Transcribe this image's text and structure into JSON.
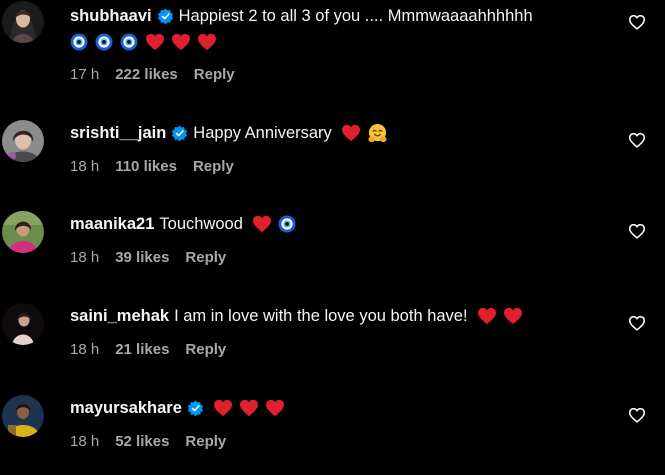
{
  "comments": [
    {
      "username": "shubhaavi",
      "verified": true,
      "text": "Happiest 2 to all 3 of you .... Mmmwaaaahhhhhh",
      "emojis_line2": [
        "nazar-amulet",
        "nazar-amulet",
        "nazar-amulet",
        "red-heart",
        "red-heart",
        "red-heart"
      ],
      "time": "17 h",
      "likes": "222 likes",
      "reply": "Reply"
    },
    {
      "username": "srishti__jain",
      "verified": true,
      "text": "Happy Anniversary",
      "emojis": [
        "red-heart",
        "hugging-face"
      ],
      "time": "18 h",
      "likes": "110 likes",
      "reply": "Reply"
    },
    {
      "username": "maanika21",
      "verified": false,
      "text": "Touchwood",
      "emojis": [
        "red-heart",
        "nazar-amulet"
      ],
      "time": "18 h",
      "likes": "39 likes",
      "reply": "Reply"
    },
    {
      "username": "saini_mehak",
      "verified": false,
      "text": "I am in love with the love you both have!",
      "emojis": [
        "red-heart",
        "red-heart"
      ],
      "time": "18 h",
      "likes": "21 likes",
      "reply": "Reply"
    },
    {
      "username": "mayursakhare",
      "verified": true,
      "text": "",
      "emojis": [
        "red-heart",
        "red-heart",
        "red-heart"
      ],
      "time": "18 h",
      "likes": "52 likes",
      "reply": "Reply"
    }
  ],
  "colors": {
    "background": "#000000",
    "primary_text": "#f5f5f5",
    "secondary_text": "#a8a8a8",
    "verified_blue": "#0095f6",
    "heart_red": "#e0202e"
  }
}
